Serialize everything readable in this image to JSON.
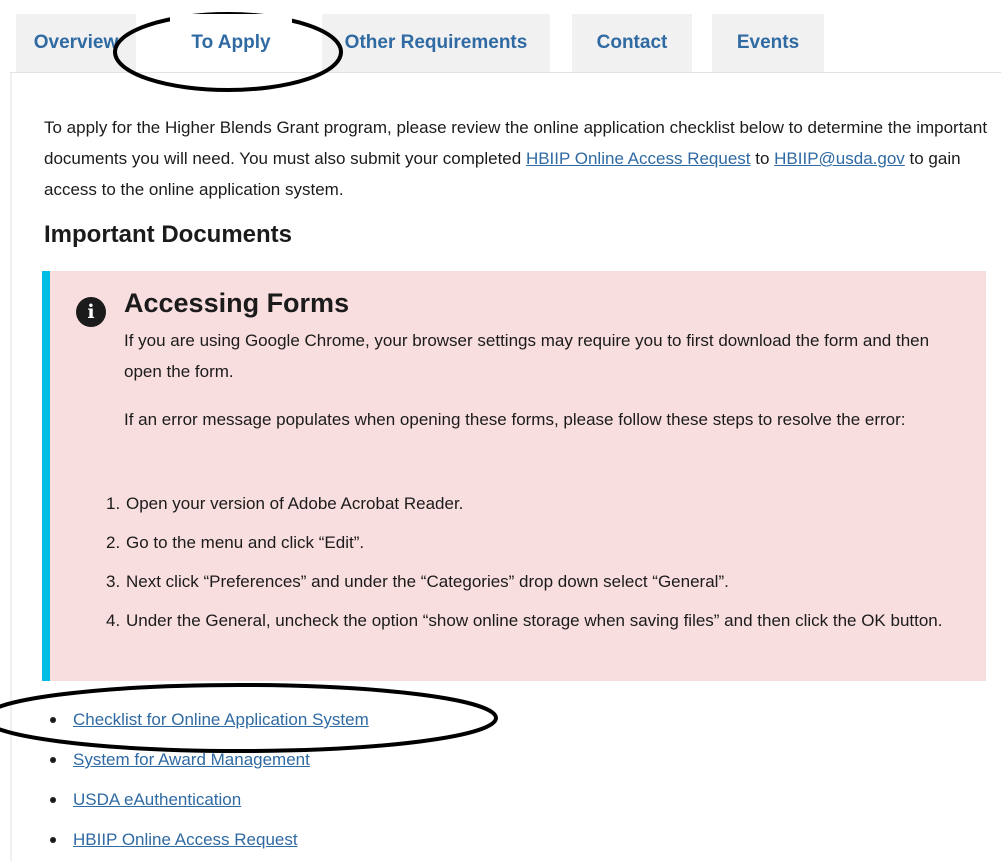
{
  "tabs": [
    {
      "label": "Overview"
    },
    {
      "label": "To Apply",
      "active": true
    },
    {
      "label": "Other Requirements"
    },
    {
      "label": "Contact"
    },
    {
      "label": "Events"
    }
  ],
  "intro": {
    "part1": "To apply for the Higher Blends Grant program, please review the online application checklist below to determine the important documents you will need. You must also submit your completed ",
    "link1": "HBIIP Online Access Request",
    "part2": " to ",
    "link2": "HBIIP@usda.gov",
    "part3": " to gain access to the online application system."
  },
  "section_title": "Important Documents",
  "alert": {
    "icon": "info-icon",
    "icon_glyph": "i",
    "heading": "Accessing Forms",
    "paragraph1": "If you are using Google Chrome, your browser settings may require you to first download the form and then open the form.",
    "paragraph2": "If an error message populates when opening these forms, please follow these steps to resolve the error:",
    "steps": [
      {
        "num": "1.",
        "text": "Open your version of Adobe Acrobat Reader."
      },
      {
        "num": "2.",
        "text": "Go to the menu and click “Edit”."
      },
      {
        "num": "3.",
        "text": "Next click “Preferences” and under the “Categories” drop down select “General”."
      },
      {
        "num": "4.",
        "text": "Under the General, uncheck the option “show online storage when saving files” and then click the OK button."
      }
    ]
  },
  "links": [
    {
      "label": "Checklist for Online Application System"
    },
    {
      "label": "System for Award Management"
    },
    {
      "label": "USDA eAuthentication"
    },
    {
      "label": "HBIIP Online Access Request"
    }
  ],
  "colors": {
    "link": "#2f6aa3",
    "alert_background": "#f9dedf",
    "alert_border": "#00bde3",
    "tab_inactive_background": "#f1f1f1"
  }
}
